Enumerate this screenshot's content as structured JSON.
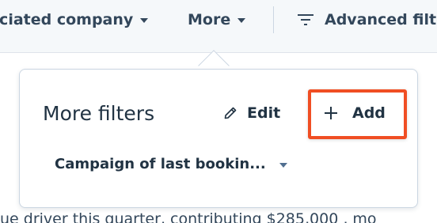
{
  "filter_bar": {
    "associated_company_label": "ociated company",
    "more_label": "More",
    "advanced_filters_label": "Advanced filte"
  },
  "popover": {
    "title": "More filters",
    "edit_label": "Edit",
    "add_label": "Add",
    "filter_select_value": "Campaign of last bookin..."
  },
  "background": {
    "body_text": "ue driver this quarter, contributing $285,000 , mo"
  },
  "colors": {
    "highlight": "#f04e23",
    "text_dark": "#213343",
    "bar_bg": "#f5f8fa"
  }
}
